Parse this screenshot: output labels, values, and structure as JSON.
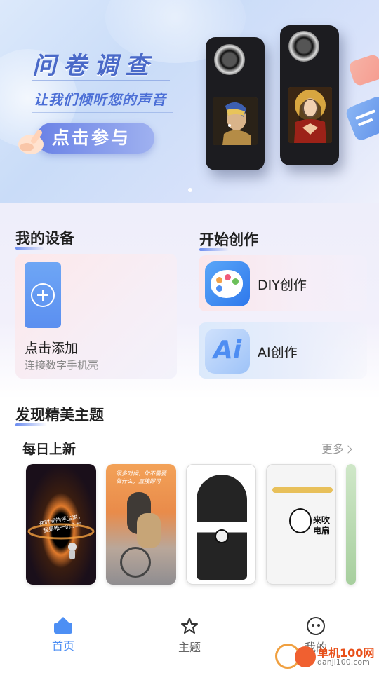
{
  "banner": {
    "title": "问卷调查",
    "subtitle": "让我们倾听您的声音",
    "cta_label": "点击参与"
  },
  "my_devices": {
    "title": "我的设备",
    "add_label": "点击添加",
    "add_sub": "连接数字手机壳"
  },
  "create": {
    "title": "开始创作",
    "diy_label": "DIY创作",
    "ai_label": "AI创作",
    "ai_icon_text": "Ai"
  },
  "discover": {
    "title": "发现精美主题",
    "daily_title": "每日上新",
    "more_label": "更多",
    "cards": [
      {
        "caption": "在时间的浮尘里，\n我是唯一的永恒"
      },
      {
        "caption": "很多时候，你不需要\n做什么，直接即可"
      },
      {
        "caption": ""
      },
      {
        "caption": "来吹\n电扇"
      }
    ]
  },
  "nav": {
    "home": "首页",
    "theme": "主题",
    "mine": "我的"
  },
  "watermark": {
    "name": "单机100网",
    "url": "danji100.com"
  },
  "colors": {
    "accent": "#4d8ff4",
    "cta": "#6a82e6"
  }
}
